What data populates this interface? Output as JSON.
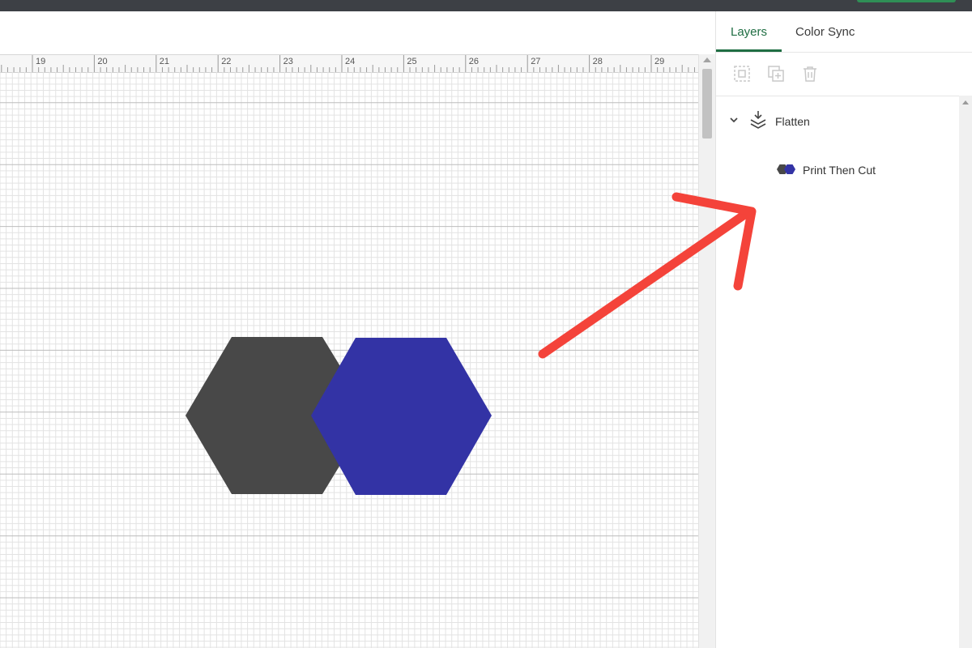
{
  "colors": {
    "accent": "#1f6e43",
    "hexagon_dark": "#484848",
    "hexagon_blue": "#3333a5",
    "arrow": "#f4433a"
  },
  "ruler": {
    "labels": [
      "19",
      "20",
      "21",
      "22",
      "23",
      "24",
      "25",
      "26",
      "27",
      "28",
      "29"
    ]
  },
  "layers_panel": {
    "tabs": [
      {
        "label": "Layers",
        "active": true
      },
      {
        "label": "Color Sync",
        "active": false
      }
    ],
    "tool_icons": [
      "group-icon",
      "duplicate-icon",
      "trash-icon"
    ],
    "group": {
      "icon": "flatten-icon",
      "label": "Flatten",
      "expanded": true,
      "child": {
        "icon": "hexagon-pair-thumbnail-icon",
        "label": "Print Then Cut"
      }
    }
  },
  "canvas": {
    "shapes": [
      {
        "name": "hexagon-dark",
        "color": "#484848"
      },
      {
        "name": "hexagon-blue",
        "color": "#3333a5"
      }
    ],
    "annotation": "red-arrow-icon"
  }
}
